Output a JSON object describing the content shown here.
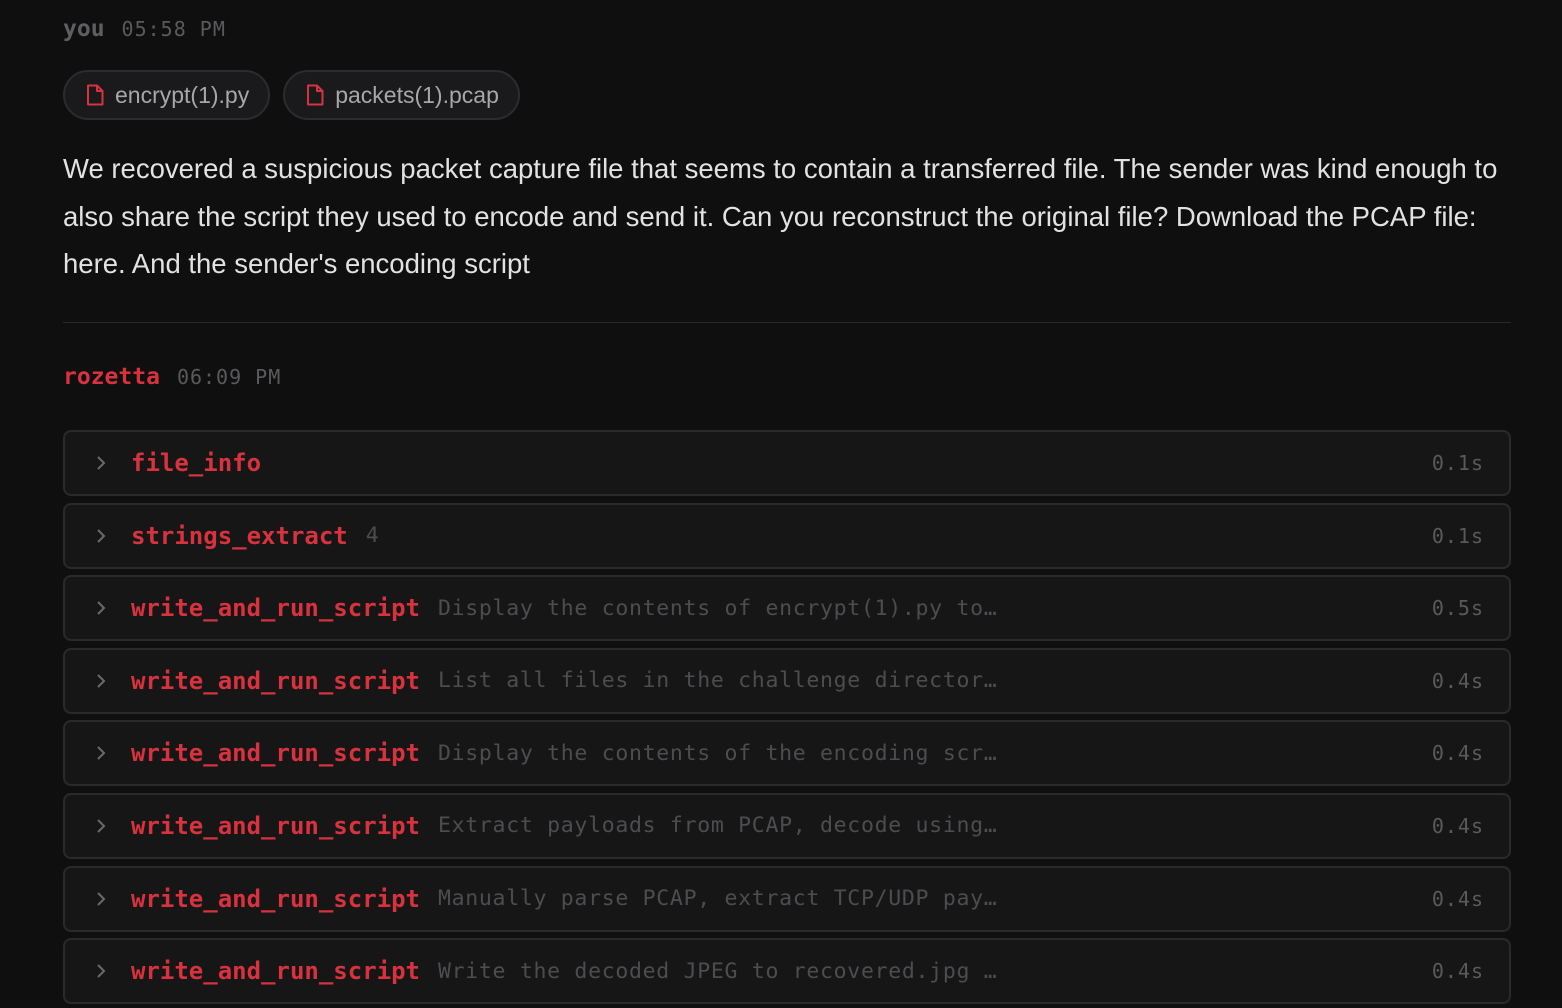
{
  "user_message": {
    "author": "you",
    "timestamp": "05:58 PM",
    "attachments": [
      {
        "name": "encrypt(1).py",
        "icon": "file-icon"
      },
      {
        "name": "packets(1).pcap",
        "icon": "file-icon"
      }
    ],
    "text": "We recovered a suspicious packet capture file that seems to contain a transferred file. The sender was kind enough to also share the script they used to encode and send it. Can you reconstruct the original file? Download the PCAP file: here. And the sender's encoding script"
  },
  "assistant_message": {
    "author": "rozetta",
    "timestamp": "06:09 PM",
    "tool_calls": [
      {
        "name": "file_info",
        "detail": "",
        "duration": "0.1s"
      },
      {
        "name": "strings_extract",
        "detail": "4",
        "duration": "0.1s"
      },
      {
        "name": "write_and_run_script",
        "detail": "Display the contents of encrypt(1).py to…",
        "duration": "0.5s"
      },
      {
        "name": "write_and_run_script",
        "detail": "List all files in the challenge director…",
        "duration": "0.4s"
      },
      {
        "name": "write_and_run_script",
        "detail": "Display the contents of the encoding scr…",
        "duration": "0.4s"
      },
      {
        "name": "write_and_run_script",
        "detail": "Extract payloads from PCAP, decode using…",
        "duration": "0.4s"
      },
      {
        "name": "write_and_run_script",
        "detail": "Manually parse PCAP, extract TCP/UDP pay…",
        "duration": "0.4s"
      },
      {
        "name": "write_and_run_script",
        "detail": "Write the decoded JPEG to recovered.jpg …",
        "duration": "0.4s"
      }
    ]
  },
  "colors": {
    "background": "#0f0f10",
    "accent": "#d8323f",
    "muted": "#5a5a5d"
  }
}
